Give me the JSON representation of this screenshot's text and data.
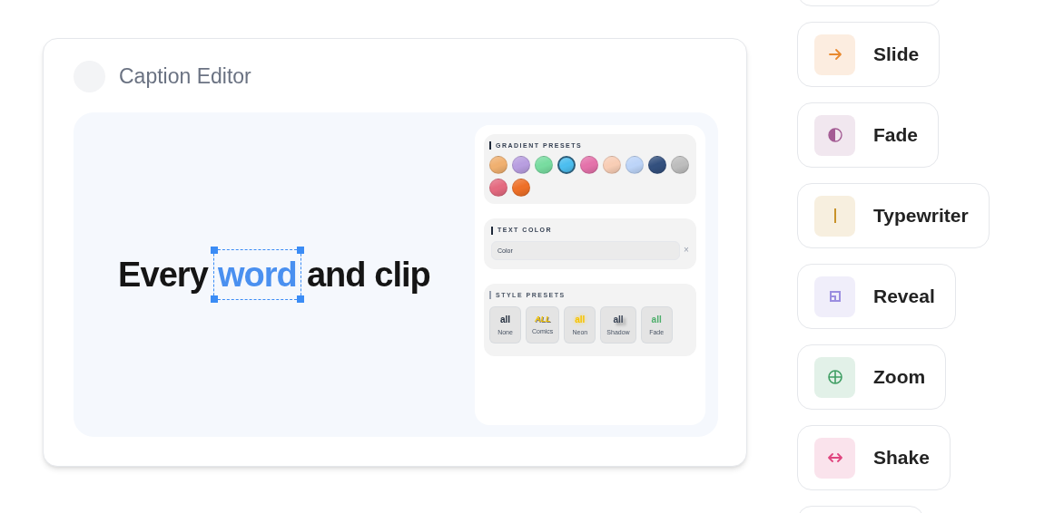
{
  "editor": {
    "title": "Caption Editor",
    "caption": {
      "before": "Every",
      "selected_word": "word",
      "after": "and clip"
    },
    "gradient_presets": {
      "heading": "GRADIENT PRESETS",
      "swatches": [
        {
          "color": "#f0b070",
          "selected": false
        },
        {
          "color": "#b89ee0",
          "selected": false
        },
        {
          "color": "#78dca0",
          "selected": false
        },
        {
          "color": "#4cbeef",
          "selected": true
        },
        {
          "color": "#e472aa",
          "selected": false
        },
        {
          "color": "#f8cdb5",
          "selected": false
        },
        {
          "color": "#bcd4f8",
          "selected": false
        },
        {
          "color": "#33507e",
          "selected": false
        },
        {
          "color": "#bdbdbd",
          "selected": false
        },
        {
          "color": "#e46a80",
          "selected": false
        },
        {
          "color": "#ee7028",
          "selected": false
        }
      ]
    },
    "text_color": {
      "heading": "TEXT COLOR",
      "placeholder": "Color",
      "clear": "×"
    },
    "style_presets": {
      "heading": "STYLE PRESETS",
      "items": [
        {
          "kind": "none",
          "sample": "all",
          "label": "None"
        },
        {
          "kind": "comics",
          "sample": "ALL",
          "label": "Comics"
        },
        {
          "kind": "neon",
          "sample": "all",
          "label": "Neon"
        },
        {
          "kind": "shadow",
          "sample": "all",
          "label": "Shadow"
        },
        {
          "kind": "fade",
          "sample": "all",
          "label": "Fade"
        }
      ]
    }
  },
  "effects": [
    {
      "kind": "arrow",
      "label": "Slide",
      "color": "#e8892f"
    },
    {
      "kind": "half",
      "label": "Fade",
      "color": "#a45c94"
    },
    {
      "kind": "bar",
      "label": "Typewriter",
      "color": "#c8922a"
    },
    {
      "kind": "square",
      "label": "Reveal",
      "color": "#9b8ee0"
    },
    {
      "kind": "cross",
      "label": "Zoom",
      "color": "#3f9e63"
    },
    {
      "kind": "double",
      "label": "Shake",
      "color": "#e0457f"
    }
  ]
}
